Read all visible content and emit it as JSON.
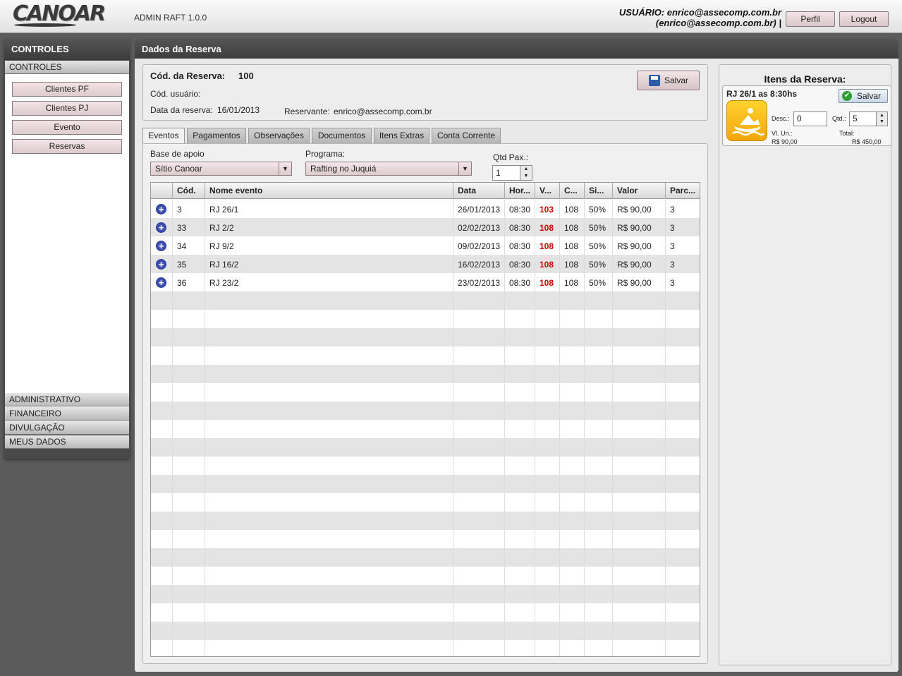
{
  "header": {
    "logo": "CANOAR",
    "app_name": "ADMIN RAFT 1.0.0",
    "user_line1": "USUÁRIO: enrico@assecomp.com.br",
    "user_line2": "(enrico@assecomp.com.br) |",
    "profile_label": "Perfil",
    "logout_label": "Logout"
  },
  "sidebar": {
    "title": "CONTROLES",
    "active_section": "CONTROLES",
    "buttons": [
      "Clientes PF",
      "Clientes PJ",
      "Evento",
      "Reservas"
    ],
    "sections": [
      "ADMINISTRATIVO",
      "FINANCEIRO",
      "DIVULGAÇÃO",
      "MEUS DADOS"
    ]
  },
  "main": {
    "title": "Dados da Reserva",
    "reservation_code_label": "Cód. da Reserva:",
    "reservation_code": "100",
    "user_code_label": "Cód. usuário:",
    "date_label": "Data da reserva:",
    "date": "16/01/2013",
    "booker_label": "Reservante:",
    "booker": "enrico@assecomp.com.br",
    "save_label": "Salvar"
  },
  "tabs": [
    "Eventos",
    "Pagamentos",
    "Observações",
    "Documentos",
    "Itens Extras",
    "Conta Corrente"
  ],
  "form": {
    "base_label": "Base de apoio",
    "base_value": "Sítio Canoar",
    "program_label": "Programa:",
    "program_value": "Rafting no Juquiá",
    "pax_label": "Qtd Pax.:",
    "pax_value": "1"
  },
  "table": {
    "columns": [
      "",
      "Cód.",
      "Nome evento",
      "Data",
      "Hor...",
      "V...",
      "C...",
      "Si...",
      "Valor",
      "Parc..."
    ],
    "rows": [
      [
        "3",
        "RJ 26/1",
        "26/01/2013",
        "08:30",
        "103",
        "108",
        "50%",
        "R$ 90,00",
        "3"
      ],
      [
        "33",
        "RJ 2/2",
        "02/02/2013",
        "08:30",
        "108",
        "108",
        "50%",
        "R$ 90,00",
        "3"
      ],
      [
        "34",
        "RJ 9/2",
        "09/02/2013",
        "08:30",
        "108",
        "108",
        "50%",
        "R$ 90,00",
        "3"
      ],
      [
        "35",
        "RJ 16/2",
        "16/02/2013",
        "08:30",
        "108",
        "108",
        "50%",
        "R$ 90,00",
        "3"
      ],
      [
        "36",
        "RJ 23/2",
        "23/02/2013",
        "08:30",
        "108",
        "108",
        "50%",
        "R$ 90,00",
        "3"
      ]
    ]
  },
  "items_panel": {
    "title": "Itens da Reserva:",
    "item_title": "RJ 26/1 as 8:30hs",
    "save_label": "Salvar",
    "desc_label": "Desc.:",
    "desc_value": "0",
    "qty_label": "Qtd.:",
    "qty_value": "5",
    "unit_label": "Vl. Un.:",
    "unit_value": "R$ 90,00",
    "total_label": "Total:",
    "total_value": "R$ 450,00"
  },
  "colors": {
    "accent_red": "#d40000",
    "title_bar": "#444444",
    "button_pink": "#e8d6da"
  }
}
